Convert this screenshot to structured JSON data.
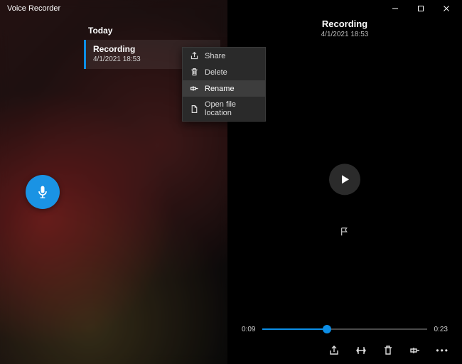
{
  "window": {
    "title": "Voice Recorder"
  },
  "left": {
    "section": "Today",
    "item": {
      "name": "Recording",
      "meta": "4/1/2021 18:53"
    }
  },
  "ctx": {
    "share": "Share",
    "delete": "Delete",
    "rename": "Rename",
    "open": "Open file location"
  },
  "right": {
    "name": "Recording",
    "meta": "4/1/2021 18:53",
    "time_current": "0:09",
    "time_total": "0:23"
  }
}
